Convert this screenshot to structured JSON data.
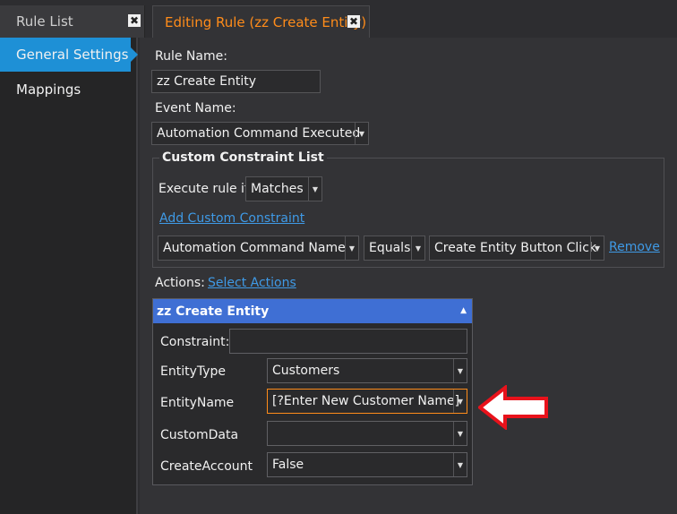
{
  "tabs": {
    "rule_list": "Rule List",
    "editing": "Editing Rule (zz Create Entity)",
    "close_glyph": "✖"
  },
  "sidebar": {
    "items": [
      {
        "label": "General Settings",
        "active": true
      },
      {
        "label": "Mappings",
        "active": false
      }
    ]
  },
  "form": {
    "rule_name_label": "Rule Name:",
    "rule_name_value": "zz Create Entity",
    "event_name_label": "Event Name:",
    "event_name_value": "Automation Command Executed",
    "constraint_list": {
      "title": "Custom Constraint List",
      "execute_label": "Execute rule if",
      "execute_value": "Matches",
      "add_link": "Add Custom Constraint",
      "row": {
        "field": "Automation Command Name",
        "operator": "Equals",
        "value": "Create Entity Button Click",
        "remove": "Remove"
      }
    },
    "actions_label": "Actions:",
    "select_actions_link": "Select Actions"
  },
  "action": {
    "title": "zz Create Entity",
    "constraint_label": "Constraint:",
    "constraint_value": "",
    "params": [
      {
        "label": "EntityType",
        "value": "Customers"
      },
      {
        "label": "EntityName",
        "value": "[?Enter New Customer Name]"
      },
      {
        "label": "CustomData",
        "value": ""
      },
      {
        "label": "CreateAccount",
        "value": "False"
      }
    ]
  },
  "colors": {
    "accent_blue": "#1e90d6",
    "tab_active_text": "#ff8c1a",
    "action_header": "#3f6fd4",
    "arrow_red": "#e8121b"
  }
}
